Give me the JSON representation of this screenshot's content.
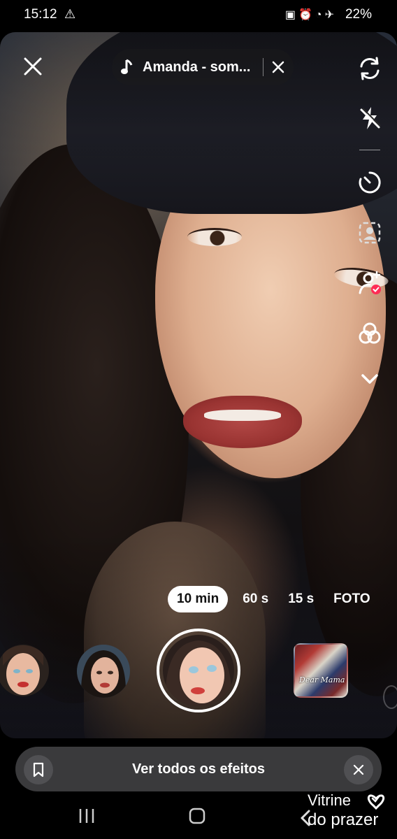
{
  "status_bar": {
    "time": "15:12",
    "warning_icon": "warning-icon",
    "icons": [
      "battery-saver-icon",
      "alarm-icon",
      "wifi-icon",
      "airplane-icon"
    ],
    "battery": "22%"
  },
  "camera": {
    "close_icon": "close-icon",
    "sound": {
      "icon": "music-note-icon",
      "label": "Amanda - som...",
      "clear_icon": "close-icon"
    }
  },
  "toolbar": {
    "items": [
      "flip-camera-icon",
      "flash-off-icon",
      "timer-icon",
      "retouch-icon",
      "add-person-icon",
      "filters-icon",
      "chevron-down-icon"
    ],
    "badge_color": "#fe2c55"
  },
  "durations": {
    "options": [
      "10 min",
      "60 s",
      "15 s",
      "FOTO"
    ],
    "selected": "10 min"
  },
  "effects": {
    "items": [
      "effect-1",
      "effect-2",
      "effect-selected"
    ]
  },
  "gallery": {
    "text": "Dear Mama"
  },
  "effects_bar": {
    "label": "Ver todos os efeitos",
    "bookmark_icon": "bookmark-icon",
    "close_icon": "close-icon"
  },
  "nav": {
    "items": [
      "recents-icon",
      "home-icon",
      "back-icon"
    ]
  },
  "watermark": {
    "line1": "Vitrine",
    "line2": "do prazer"
  },
  "colors": {
    "bar_bg": "#3a3a3c",
    "pill_bg": "#ffffff",
    "accent": "#fe2c55"
  }
}
